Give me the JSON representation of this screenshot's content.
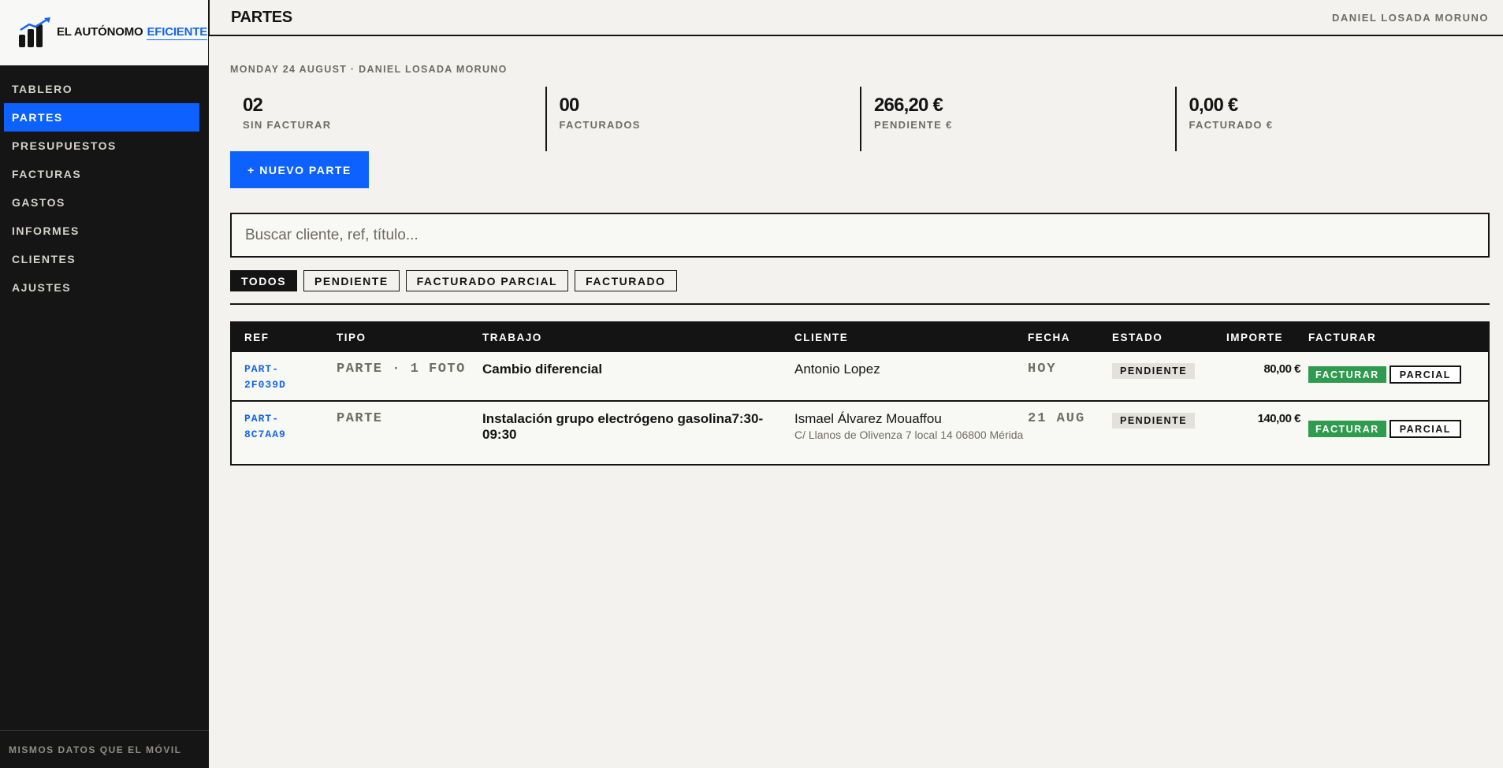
{
  "app": {
    "brand_part1": "EL AUTÓNOMO",
    "brand_part2": "EFICIENTE",
    "logo_icon": "bar-chart-growth-icon",
    "accent_color": "#0d62ff"
  },
  "sidebar": {
    "items": [
      {
        "label": "TABLERO",
        "active": false
      },
      {
        "label": "PARTES",
        "active": true
      },
      {
        "label": "PRESUPUESTOS",
        "active": false
      },
      {
        "label": "FACTURAS",
        "active": false
      },
      {
        "label": "GASTOS",
        "active": false
      },
      {
        "label": "INFORMES",
        "active": false
      },
      {
        "label": "CLIENTES",
        "active": false
      },
      {
        "label": "AJUSTES",
        "active": false
      }
    ],
    "footer": "MISMOS DATOS QUE EL MÓVIL"
  },
  "header": {
    "title": "PARTES",
    "user": "DANIEL LOSADA MORUNO"
  },
  "main": {
    "subtitle": "MONDAY 24 AUGUST · DANIEL LOSADA MORUNO",
    "stats": [
      {
        "value": "02",
        "label": "SIN FACTURAR"
      },
      {
        "value": "00",
        "label": "FACTURADOS"
      },
      {
        "value": "266,20 €",
        "label": "PENDIENTE €"
      },
      {
        "value": "0,00 €",
        "label": "FACTURADO €"
      }
    ],
    "new_button": "+ NUEVO PARTE",
    "search_placeholder": "Buscar cliente, ref, título...",
    "filters": [
      {
        "label": "TODOS",
        "active": true
      },
      {
        "label": "PENDIENTE",
        "active": false
      },
      {
        "label": "FACTURADO PARCIAL",
        "active": false
      },
      {
        "label": "FACTURADO",
        "active": false
      }
    ]
  },
  "table": {
    "columns": [
      "REF",
      "TIPO",
      "TRABAJO",
      "CLIENTE",
      "FECHA",
      "ESTADO",
      "IMPORTE",
      "FACTURAR"
    ],
    "rows": [
      {
        "ref_line1": "PART-",
        "ref_line2": "2F039D",
        "tipo": "PARTE · 1 FOTO",
        "trabajo": "Cambio diferencial",
        "cliente": "Antonio Lopez",
        "direccion": "",
        "fecha": "HOY",
        "estado": "PENDIENTE",
        "importe": "80,00 €",
        "facturar_label": "FACTURAR",
        "parcial_label": "PARCIAL"
      },
      {
        "ref_line1": "PART-",
        "ref_line2": "8C7AA9",
        "tipo": "PARTE",
        "trabajo": "Instalación grupo electrógeno gasolina7:30-09:30",
        "cliente": "Ismael Álvarez Mouaffou",
        "direccion": "C/ Llanos de Olivenza 7 local 14 06800 Mérida",
        "fecha": "21 AUG",
        "estado": "PENDIENTE",
        "importe": "140,00 €",
        "facturar_label": "FACTURAR",
        "parcial_label": "PARCIAL"
      }
    ]
  }
}
